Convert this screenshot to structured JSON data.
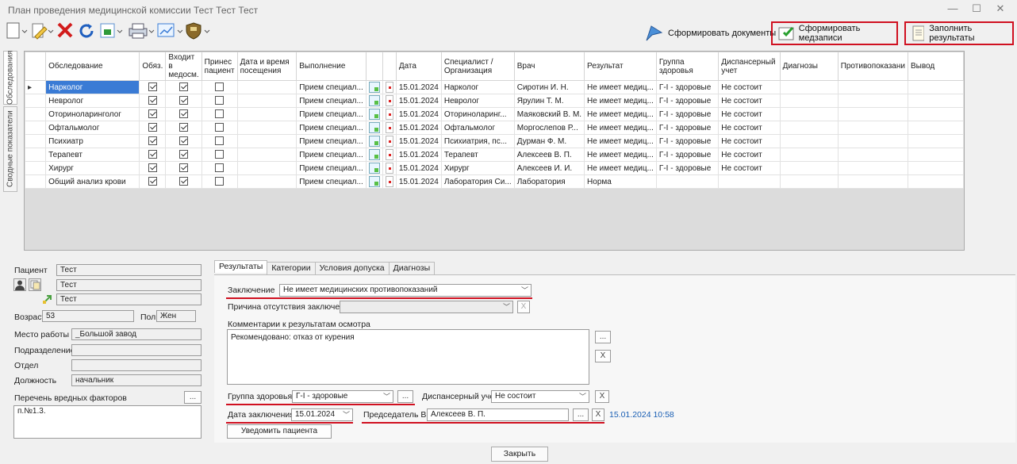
{
  "window": {
    "title": "План проведения медицинской комиссии Тест Тест Тест",
    "min": "—",
    "max": "☐",
    "close": "✕"
  },
  "toolbar": {
    "make_docs": "Сформировать документы",
    "make_records": "Сформировать медзаписи",
    "fill_results": "Заполнить результаты"
  },
  "side_tabs": [
    "Обследования",
    "Сводные показатели"
  ],
  "grid": {
    "columns": [
      "Обследование",
      "Обяз.",
      "Входит в медосм.",
      "Принес пациент",
      "Дата и время посещения",
      "Выполнение",
      "",
      "",
      "Дата",
      "Специалист / Организация",
      "Врач",
      "Результат",
      "Группа здоровья",
      "Диспансерный учет",
      "Диагнозы",
      "Противопоказани",
      "Вывод"
    ],
    "rows": [
      {
        "exam": "Нарколог",
        "obyaz": true,
        "medosm": true,
        "prines": false,
        "visit": "",
        "exec": "Прием специал...",
        "date": "15.01.2024",
        "spec": "Нарколог",
        "doctor": "Сиротин И. Н.",
        "result": "Не имеет медиц...",
        "group": "Г-I - здоровые",
        "disp": "Не состоит",
        "diag": "",
        "contra": "",
        "concl": ""
      },
      {
        "exam": "Невролог",
        "obyaz": true,
        "medosm": true,
        "prines": false,
        "visit": "",
        "exec": "Прием специал...",
        "date": "15.01.2024",
        "spec": "Невролог",
        "doctor": "Ярулин Т. М.",
        "result": "Не имеет медиц...",
        "group": "Г-I - здоровые",
        "disp": "Не состоит",
        "diag": "",
        "contra": "",
        "concl": ""
      },
      {
        "exam": "Оториноларинголог",
        "obyaz": true,
        "medosm": true,
        "prines": false,
        "visit": "",
        "exec": "Прием специал...",
        "date": "15.01.2024",
        "spec": "Оториноларинг...",
        "doctor": "Маяковский В. М.",
        "result": "Не имеет медиц...",
        "group": "Г-I - здоровые",
        "disp": "Не состоит",
        "diag": "",
        "contra": "",
        "concl": ""
      },
      {
        "exam": "Офтальмолог",
        "obyaz": true,
        "medosm": true,
        "prines": false,
        "visit": "",
        "exec": "Прием специал...",
        "date": "15.01.2024",
        "spec": "Офтальмолог",
        "doctor": "Моргослепов Р...",
        "result": "Не имеет медиц...",
        "group": "Г-I - здоровые",
        "disp": "Не состоит",
        "diag": "",
        "contra": "",
        "concl": ""
      },
      {
        "exam": "Психиатр",
        "obyaz": true,
        "medosm": true,
        "prines": false,
        "visit": "",
        "exec": "Прием специал...",
        "date": "15.01.2024",
        "spec": "Психиатрия, пс...",
        "doctor": "Дурман Ф. М.",
        "result": "Не имеет медиц...",
        "group": "Г-I - здоровые",
        "disp": "Не состоит",
        "diag": "",
        "contra": "",
        "concl": ""
      },
      {
        "exam": "Терапевт",
        "obyaz": true,
        "medosm": true,
        "prines": false,
        "visit": "",
        "exec": "Прием специал...",
        "date": "15.01.2024",
        "spec": "Терапевт",
        "doctor": "Алексеев В. П.",
        "result": "Не имеет медиц...",
        "group": "Г-I - здоровые",
        "disp": "Не состоит",
        "diag": "",
        "contra": "",
        "concl": ""
      },
      {
        "exam": "Хирург",
        "obyaz": true,
        "medosm": true,
        "prines": false,
        "visit": "",
        "exec": "Прием специал...",
        "date": "15.01.2024",
        "spec": "Хирург",
        "doctor": "Алексеев И. И.",
        "result": "Не имеет медиц...",
        "group": "Г-I - здоровые",
        "disp": "Не состоит",
        "diag": "",
        "contra": "",
        "concl": ""
      },
      {
        "exam": "Общий анализ крови",
        "obyaz": true,
        "medosm": true,
        "prines": false,
        "visit": "",
        "exec": "Прием специал...",
        "date": "15.01.2024",
        "spec": "Лаборатория Си...",
        "doctor": "Лаборатория",
        "result": "Норма",
        "group": "",
        "disp": "",
        "diag": "",
        "contra": "",
        "concl": ""
      }
    ]
  },
  "patient": {
    "label_patient": "Пациент",
    "surname": "Тест",
    "name": "Тест",
    "patronymic": "Тест",
    "label_age": "Возраст",
    "age": "53",
    "label_sex": "Пол",
    "sex": "Жен",
    "label_work": "Место работы",
    "work": "_Большой завод",
    "label_division": "Подразделение",
    "division": "",
    "label_dept": "Отдел",
    "dept": "",
    "label_position": "Должность",
    "position": "начальник",
    "label_factors": "Перечень вредных факторов",
    "factors": "п.№1.3.",
    "dots": "..."
  },
  "tabs": [
    "Результаты",
    "Категории",
    "Условия допуска",
    "Диагнозы"
  ],
  "results": {
    "label_conclusion": "Заключение",
    "conclusion": "Не имеет медицинских противопоказаний",
    "label_absence": "Причина отсутствия заключения",
    "absence": "",
    "label_comments": "Комментарии к результатам осмотра",
    "comments": "Рекомендовано: отказ от курения",
    "label_group": "Группа здоровья",
    "group": "Г-I - здоровые",
    "label_disp": "Диспансерный учет",
    "disp": "Не состоит",
    "label_date": "Дата заключения",
    "date": "15.01.2024",
    "label_chair": "Председатель ВК",
    "chair": "Алексеев В. П.",
    "timestamp": "15.01.2024 10:58",
    "notify": "Уведомить пациента",
    "dots": "...",
    "x": "X"
  },
  "close_button": "Закрыть",
  "colors": {
    "highlight": "#d01020",
    "selection": "#3a7bd5",
    "link": "#1a5fb4"
  }
}
